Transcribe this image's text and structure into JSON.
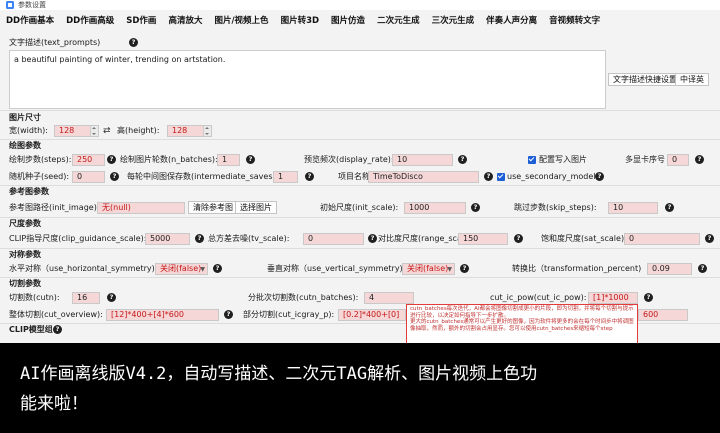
{
  "window": {
    "title": "参数设置"
  },
  "menu": [
    "DD作画基本",
    "DD作画高级",
    "SD作画",
    "高清放大",
    "图片/视频上色",
    "图片转3D",
    "图片仿造",
    "二次元生成",
    "三次元生成",
    "伴奏人声分离",
    "音视频转文字"
  ],
  "text_prompts": {
    "label": "文字描述(text_prompts)",
    "value": "a beautiful painting of winter, trending on artstation.",
    "quick_set_button": "文字描述快捷设置",
    "translate_button": "中译英"
  },
  "image_size": {
    "section": "图片尺寸",
    "width_label": "宽(width):",
    "width": "128",
    "height_label": "高(height):",
    "height": "128",
    "swap_icon": "⇄"
  },
  "draw": {
    "section": "绘图参数",
    "steps_label": "绘制步数(steps):",
    "steps": "250",
    "n_batches_label": "绘制图片轮数(n_batches):",
    "n_batches": "1",
    "display_rate_label": "预览频次(display_rate):",
    "display_rate": "10",
    "write_config_label": "配置写入图片",
    "gpu_label": "多显卡序号",
    "gpu": "0",
    "seed_label": "随机种子(seed):",
    "seed": "0",
    "intermediate_label": "每轮中间图保存数(intermediate_saves):",
    "intermediate": "1",
    "project_label": "项目名称",
    "project": "TimeToDisco",
    "secondary_label": "use_secondary_model"
  },
  "reference": {
    "section": "参考图参数",
    "init_image_label": "参考图路径(init_image):",
    "init_image": "无(null)",
    "clear_button": "清除参考图",
    "select_button": "选择图片",
    "init_scale_label": "初始尺度(init_scale):",
    "init_scale": "1000",
    "skip_label": "跳过步数(skip_steps):",
    "skip": "10"
  },
  "scale": {
    "section": "尺度参数",
    "clip_label": "CLIP指导尺度(clip_guidance_scale):",
    "clip": "5000",
    "tv_label": "总方差去噪(tv_scale):",
    "tv": "0",
    "range_label": "对比度尺度(range_scale):",
    "range": "150",
    "sat_label": "饱和度尺度(sat_scale):",
    "sat": "0"
  },
  "symmetry": {
    "section": "对称参数",
    "h_label": "水平对称（use_horizontal_symmetry)",
    "h": "关闭(false)",
    "v_label": "垂直对称（use_vertical_symmetry)",
    "v": "关闭(false)",
    "transform_label": "转换比（transformation_percent)",
    "transform": "0.09"
  },
  "cut": {
    "section": "切割参数",
    "cutn_label": "切割数(cutn):",
    "cutn": "16",
    "cutn_batches_label": "分批次切割数(cutn_batches):",
    "cutn_batches": "4",
    "ic_pow_label": "cut_ic_pow(cut_ic_pow):",
    "ic_pow": "[1]*1000",
    "overview_label": "整体切割(cut_overview):",
    "overview": "[12]*400+[4]*600",
    "icgray_label": "部分切割(cut_icgray_p):",
    "icgray": "[0.2]*400+[0]",
    "extra_value": "600",
    "clip_model_section": "CLIP模型组"
  },
  "tooltip": {
    "lines": [
      "cutn_batches每次迭代，AI都会将图像切割成更小的片段，即为切割，并将每个切割与提示进行比较，以决定如何指导下一步扩散。",
      "更大的cutn_batches通常可以产生更好的图像，因为软件将更多的会在每个时间步中将调图像抽取，然而，额外的切割会占用显存。您可以使用cutn_batches来缩短每个step"
    ]
  },
  "banner": {
    "line1": "AI作画离线版V4.2，自动写描述、二次元TAG解析、图片视频上色功",
    "line2": "能来啦！"
  }
}
